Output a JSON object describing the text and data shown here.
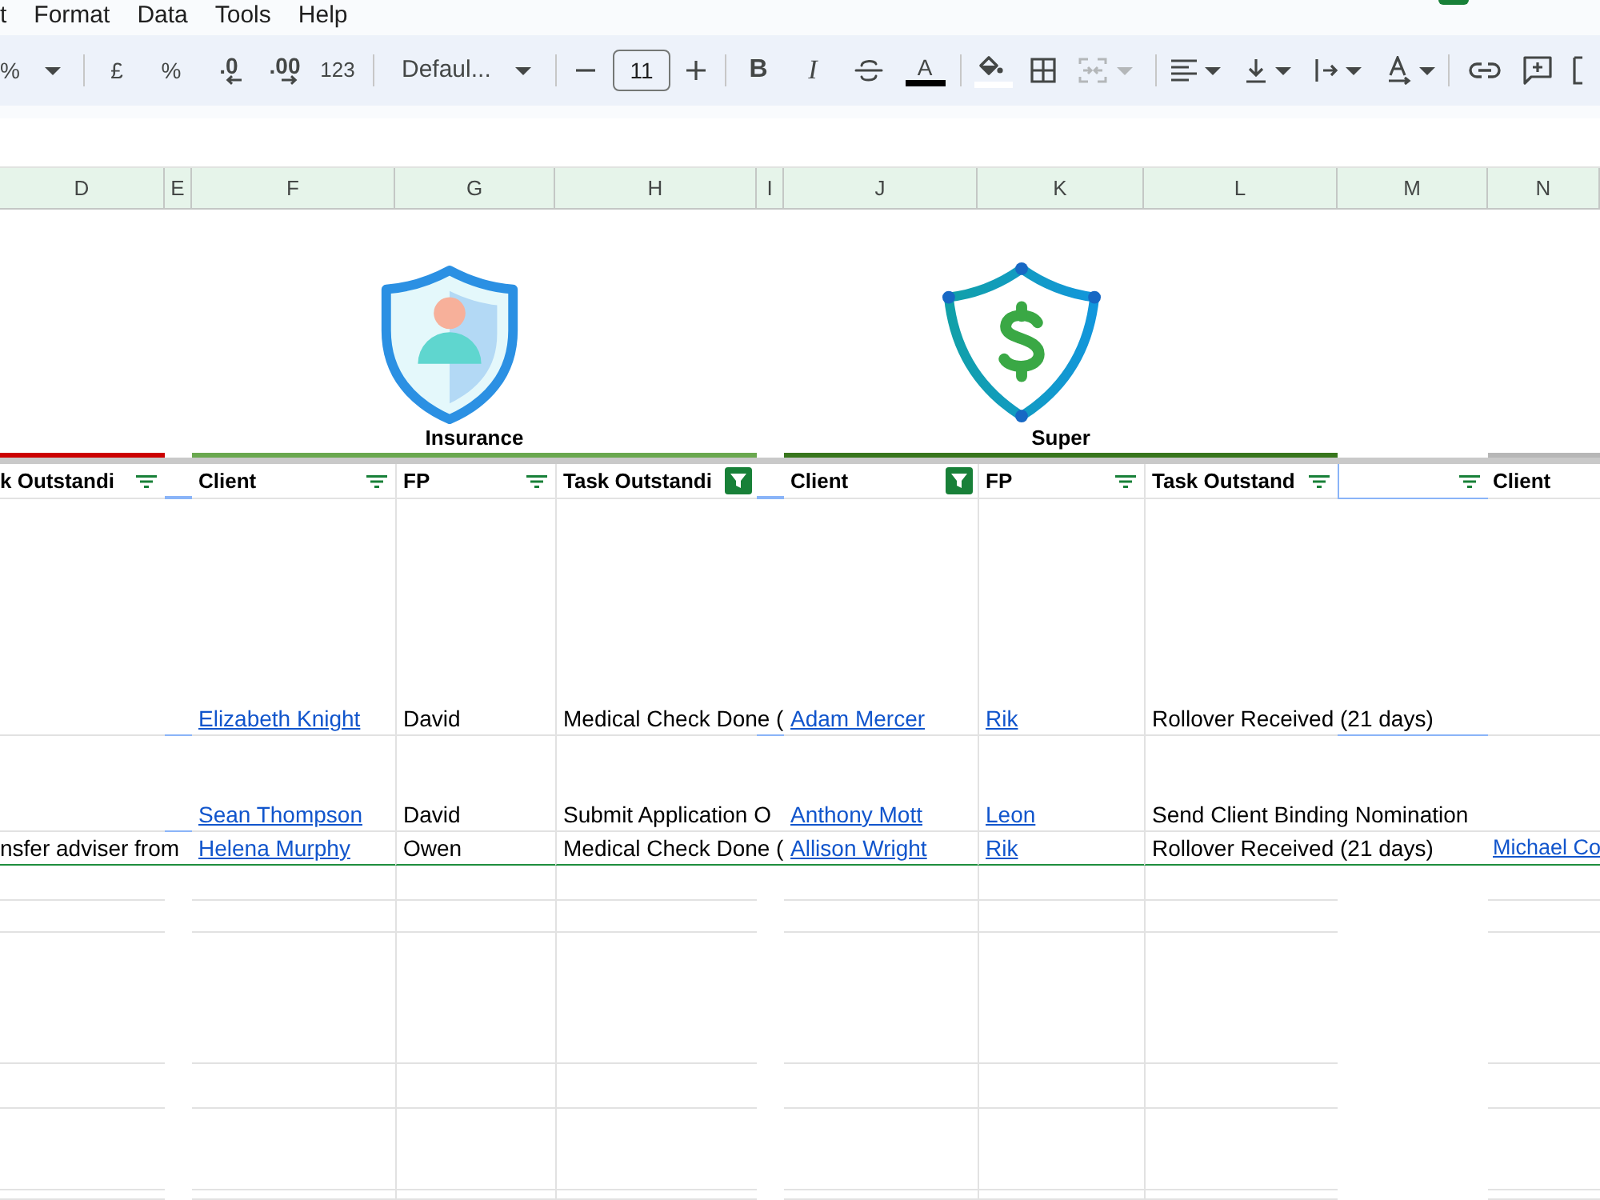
{
  "menu_bar": {
    "items": [
      "t",
      "Format",
      "Data",
      "Tools",
      "Help"
    ]
  },
  "toolbar": {
    "zoom": "%",
    "currency": "£",
    "percent": "%",
    "decrease_decimal": ".0",
    "increase_decimal": ".00",
    "number_format": "123",
    "font": "Defaul...",
    "font_size": "11",
    "bold": "B",
    "italic": "I",
    "text_color": "A",
    "merge_cells": {
      "disabled": true
    }
  },
  "sheet": {
    "columns": [
      {
        "letter": "D",
        "header": "k Outstandi",
        "filtered": false
      },
      {
        "letter": "E"
      },
      {
        "letter": "F",
        "header": "Client",
        "filtered": false
      },
      {
        "letter": "G",
        "header": "FP",
        "filtered": false
      },
      {
        "letter": "H",
        "header": "Task Outstandi",
        "filtered": true
      },
      {
        "letter": "I"
      },
      {
        "letter": "J",
        "header": "Client",
        "filtered": true
      },
      {
        "letter": "K",
        "header": "FP",
        "filtered": false
      },
      {
        "letter": "L",
        "header": "Task Outstand",
        "filtered": false
      },
      {
        "letter": "M",
        "filtered": false
      },
      {
        "letter": "N",
        "header": "Client"
      }
    ],
    "sections": [
      {
        "color": "#cc0000"
      },
      {
        "title": "Insurance",
        "color": "#6aa84f"
      },
      {
        "title": "Super",
        "color": "#38761d"
      },
      {
        "color": "#b7b7b7"
      }
    ],
    "rows": [
      [
        null,
        null,
        {
          "text": "Elizabeth Knight",
          "link": true
        },
        {
          "text": "David",
          "link": false
        },
        {
          "text": "Medical Check Done (",
          "link": false
        },
        null,
        {
          "text": "Adam Mercer",
          "link": true
        },
        {
          "text": "Rik",
          "link": true
        },
        {
          "text": "Rollover Received (21 days)",
          "link": false
        },
        null,
        null
      ],
      [
        null,
        null,
        {
          "text": "Sean Thompson",
          "link": true
        },
        {
          "text": "David",
          "link": false
        },
        {
          "text": "Submit Application O",
          "link": false
        },
        null,
        {
          "text": "Anthony Mott",
          "link": true
        },
        {
          "text": "Leon",
          "link": true
        },
        {
          "text": "Send Client Binding Nomination",
          "link": false
        },
        null,
        null
      ],
      [
        {
          "text": "nsfer adviser from",
          "link": false
        },
        null,
        {
          "text": "Helena Murphy",
          "link": true
        },
        {
          "text": "Owen",
          "link": false
        },
        {
          "text": "Medical Check Done (",
          "link": false
        },
        null,
        {
          "text": "Allison Wright",
          "link": true
        },
        {
          "text": "Rik",
          "link": true
        },
        {
          "text": "Rollover Received (21 days)",
          "link": false
        },
        null,
        {
          "text": "Michael Co",
          "link": true
        }
      ]
    ]
  }
}
